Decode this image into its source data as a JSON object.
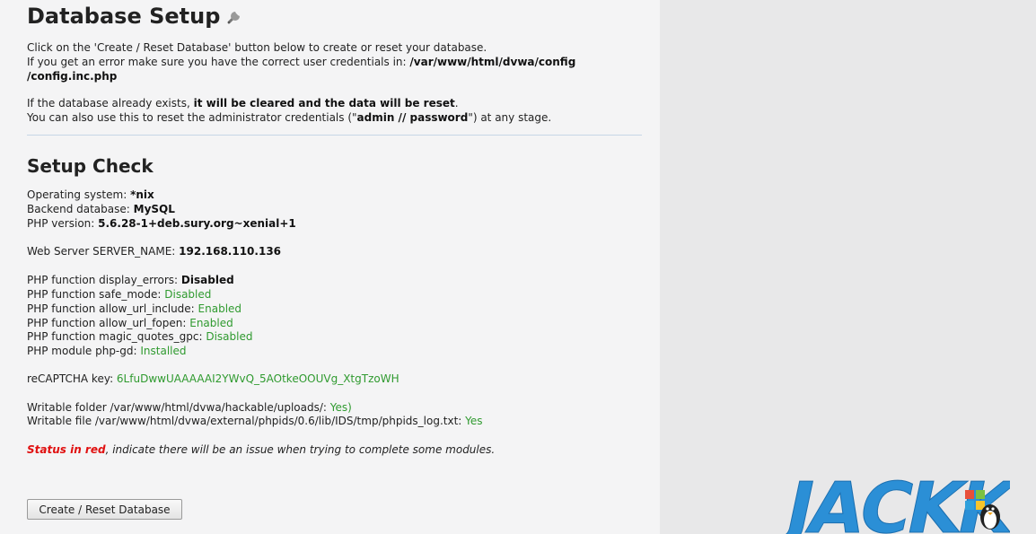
{
  "setup": {
    "title": "Database Setup",
    "intro_line1": "Click on the 'Create / Reset Database' button below to create or reset your database.",
    "intro_line2_prefix": "If you get an error make sure you have the correct user credentials in: ",
    "intro_line2_path": "/var/www/html/dvwa/config",
    "intro_line3_path": "/config.inc.php",
    "reset_line1_prefix": "If the database already exists, ",
    "reset_line1_bold": "it will be cleared and the data will be reset",
    "reset_line1_suffix": ".",
    "reset_line2_prefix": "You can also use this to reset the administrator credentials (\"",
    "reset_line2_bold": "admin // password",
    "reset_line2_suffix": "\") at any stage."
  },
  "check": {
    "title": "Setup Check",
    "os_label": "Operating system: ",
    "os_value": "*nix",
    "db_label": "Backend database: ",
    "db_value": "MySQL",
    "php_label": "PHP version: ",
    "php_value": "5.6.28-1+deb.sury.org~xenial+1",
    "server_label": "Web Server SERVER_NAME: ",
    "server_value": "192.168.110.136",
    "display_errors_label": "PHP function display_errors: ",
    "display_errors_value": "Disabled",
    "safe_mode_label": "PHP function safe_mode: ",
    "safe_mode_value": "Disabled",
    "allow_url_include_label": "PHP function allow_url_include: ",
    "allow_url_include_value": "Enabled",
    "allow_url_fopen_label": "PHP function allow_url_fopen: ",
    "allow_url_fopen_value": "Enabled",
    "magic_quotes_label": "PHP function magic_quotes_gpc: ",
    "magic_quotes_value": "Disabled",
    "php_gd_label": "PHP module php-gd: ",
    "php_gd_value": "Installed",
    "recaptcha_label": "reCAPTCHA key: ",
    "recaptcha_value": "6LfuDwwUAAAAAI2YWvQ_5AOtkeOOUVg_XtgTzoWH",
    "writable_folder_label": "Writable folder /var/www/html/dvwa/hackable/uploads/: ",
    "writable_folder_value": "Yes)",
    "writable_file_label": "Writable file /var/www/html/dvwa/external/phpids/0.6/lib/IDS/tmp/phpids_log.txt: ",
    "writable_file_value": "Yes",
    "status_red": "Status in red",
    "status_note": ", indicate there will be an issue when trying to complete some modules."
  },
  "button": {
    "label": "Create / Reset Database"
  },
  "watermark": {
    "text": "JACKK"
  },
  "colors": {
    "ok": "#2f9a2f",
    "error": "#e01010",
    "divider": "#c7d6e6"
  }
}
